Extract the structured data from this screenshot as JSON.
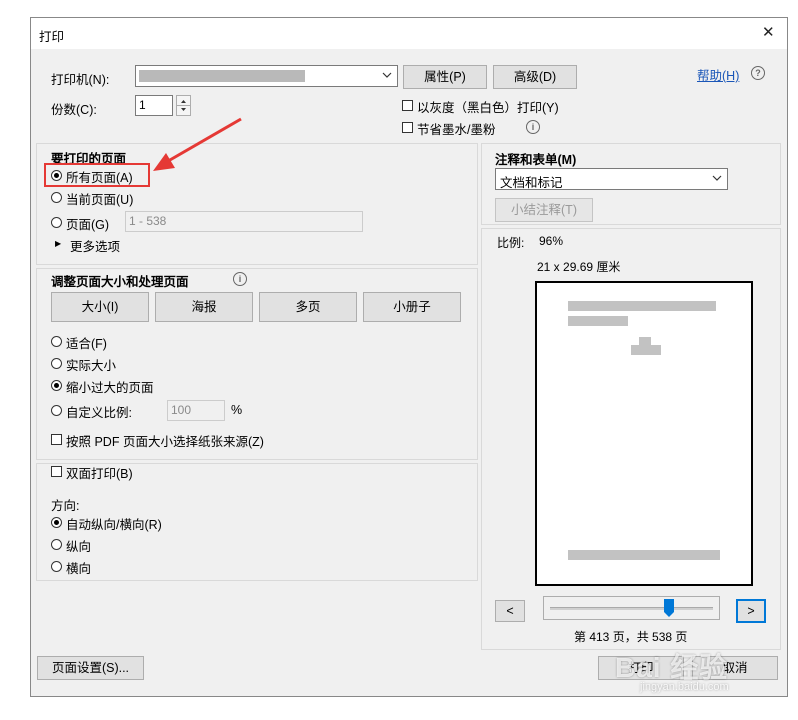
{
  "window": {
    "title": "打印",
    "close_glyph": "✕"
  },
  "printer": {
    "label": "打印机(N):",
    "properties_label": "属性(P)",
    "advanced_label": "高级(D)",
    "help_label": "帮助(H)",
    "help_glyph": "?"
  },
  "copies": {
    "label": "份数(C):",
    "value": "1"
  },
  "options": {
    "grayscale_label": "以灰度（黑白色）打印(Y)",
    "save_ink_label": "节省墨水/墨粉"
  },
  "pages": {
    "heading": "要打印的页面",
    "all_label": "所有页面(A)",
    "current_label": "当前页面(U)",
    "page_label": "页面(G)",
    "page_range": "1 - 538",
    "more_label": "更多选项",
    "selected": "all"
  },
  "sizing": {
    "heading": "调整页面大小和处理页面",
    "buttons": [
      "大小(I)",
      "海报",
      "多页",
      "小册子"
    ],
    "fit_label": "适合(F)",
    "actual_label": "实际大小",
    "shrink_label": "缩小过大的页面",
    "custom_label": "自定义比例:",
    "custom_value": "100",
    "percent": "%",
    "choose_source_label": "按照 PDF 页面大小选择纸张来源(Z)",
    "selected": "shrink"
  },
  "duplex": {
    "label": "双面打印(B)",
    "orientation_label": "方向:",
    "auto_label": "自动纵向/横向(R)",
    "portrait_label": "纵向",
    "landscape_label": "横向",
    "selected": "auto"
  },
  "annotations": {
    "heading": "注释和表单(M)",
    "value": "文档和标记",
    "summarize_label": "小结注释(T)"
  },
  "preview": {
    "scale_label": "比例:",
    "scale_value": "96%",
    "paper_size": "21 x 29.69 厘米",
    "prev_glyph": "<",
    "next_glyph": ">",
    "page_status": "第 413 页，共 538 页",
    "slider_position": 0.8
  },
  "footer": {
    "page_setup_label": "页面设置(S)...",
    "print_label": "打印",
    "cancel_label": "取消"
  },
  "watermark": {
    "text": "Bai 经验",
    "url": "jingyan.baidu.com"
  },
  "colors": {
    "annotation": "#e53935",
    "focus": "#0078d7",
    "slider": "#0078d7"
  }
}
